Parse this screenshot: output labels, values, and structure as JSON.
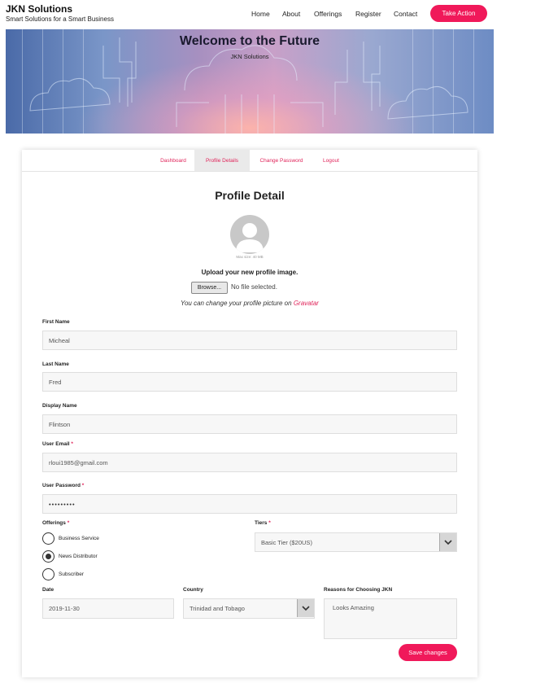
{
  "header": {
    "brand_title": "JKN Solutions",
    "brand_tagline": "Smart Solutions for a Smart Business",
    "nav": [
      "Home",
      "About",
      "Offerings",
      "Register",
      "Contact"
    ],
    "cta": "Take Action"
  },
  "hero": {
    "title": "Welcome to the Future",
    "subtitle": "JKN Solutions"
  },
  "tabs": [
    "Dashboard",
    "Profile Details",
    "Change Password",
    "Logout"
  ],
  "active_tab": "Profile Details",
  "profile": {
    "title": "Profile Detail",
    "max_size": "Max size: 40 MB",
    "upload_label": "Upload your new profile image.",
    "browse_label": "Browse...",
    "no_file": "No file selected.",
    "gravatar_text": "You can change your profile picture on",
    "gravatar_link": "Gravatar"
  },
  "form": {
    "first_name_label": "First Name",
    "first_name": "Micheal",
    "last_name_label": "Last Name",
    "last_name": "Fred",
    "display_name_label": "Display Name",
    "display_name": "Flintson",
    "email_label": "User Email",
    "email": "rloui1985@gmail.com",
    "password_label": "User Password",
    "password_mask": "•••••••••",
    "required_mark": "*",
    "offerings_label": "Offerings",
    "offerings": [
      "Business Service",
      "News Distributor",
      "Subscriber"
    ],
    "offerings_selected": "News Distributor",
    "tiers_label": "Tiers",
    "tier_value": "Basic Tier ($20US)",
    "date_label": "Date",
    "date": "2019-11-30",
    "country_label": "Country",
    "country": "Trinidad and Tobago",
    "reasons_label": "Reasons for Choosing JKN",
    "reasons": "Looks Amazing",
    "save_label": "Save changes"
  },
  "colors": {
    "accent": "#f0195a",
    "link": "#e0245a"
  },
  "icons": [
    "avatar-placeholder-icon",
    "chevron-down-icon"
  ]
}
